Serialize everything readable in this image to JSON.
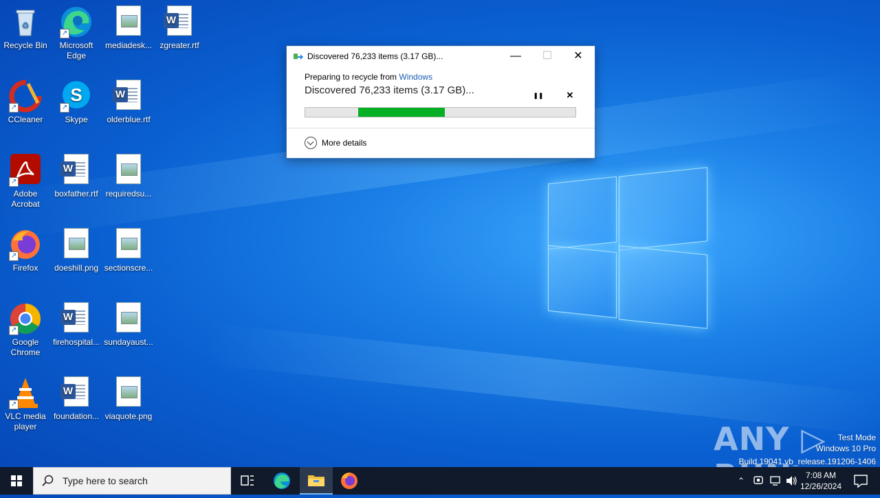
{
  "desktop": {
    "icons": [
      {
        "label": "Recycle Bin",
        "icon": "recycle-bin-icon"
      },
      {
        "label": "Microsoft Edge",
        "icon": "edge-icon"
      },
      {
        "label": "mediadesk...",
        "icon": "image-file-icon"
      },
      {
        "label": "zgreater.rtf",
        "icon": "word-doc-icon"
      },
      {
        "label": "CCleaner",
        "icon": "ccleaner-icon"
      },
      {
        "label": "Skype",
        "icon": "skype-icon"
      },
      {
        "label": "olderblue.rtf",
        "icon": "word-doc-icon"
      },
      {
        "label": "Adobe Acrobat",
        "icon": "acrobat-icon"
      },
      {
        "label": "boxfather.rtf",
        "icon": "word-doc-icon"
      },
      {
        "label": "requiredsu...",
        "icon": "image-file-icon"
      },
      {
        "label": "Firefox",
        "icon": "firefox-icon"
      },
      {
        "label": "doeshill.png",
        "icon": "image-file-icon"
      },
      {
        "label": "sectionscre...",
        "icon": "image-file-icon"
      },
      {
        "label": "Google Chrome",
        "icon": "chrome-icon"
      },
      {
        "label": "firehospital...",
        "icon": "word-doc-icon"
      },
      {
        "label": "sundayaust...",
        "icon": "image-file-icon"
      },
      {
        "label": "VLC media player",
        "icon": "vlc-icon"
      },
      {
        "label": "foundation...",
        "icon": "word-doc-icon"
      },
      {
        "label": "viaquote.png",
        "icon": "image-file-icon"
      }
    ]
  },
  "dialog": {
    "title": "Discovered 76,233 items (3.17 GB)...",
    "prep_prefix": "Preparing to recycle from ",
    "prep_location": "Windows",
    "status": "Discovered 76,233 items (3.17 GB)...",
    "pause_glyph": "❚❚",
    "cancel_glyph": "✕",
    "progress": {
      "range_start_fraction": 0.195,
      "range_end_fraction": 0.517
    },
    "more_details": "More details",
    "minimize_glyph": "—",
    "maximize_glyph": "☐",
    "close_glyph": "✕"
  },
  "watermark": {
    "brand": "ANY ▷ RUN",
    "line1": "Test Mode",
    "line2": "Windows 10 Pro",
    "line3": "Build 19041.vb_release.191206-1406"
  },
  "taskbar": {
    "search_placeholder": "Type here to search",
    "apps": [
      "task-view-icon",
      "edge-icon",
      "file-explorer-icon",
      "firefox-icon"
    ],
    "clock_time": "7:08 AM",
    "clock_date": "12/26/2024"
  },
  "colors": {
    "progress_green": "#06b025",
    "link_blue": "#1a5fb4",
    "taskbar": "#101a2a"
  }
}
